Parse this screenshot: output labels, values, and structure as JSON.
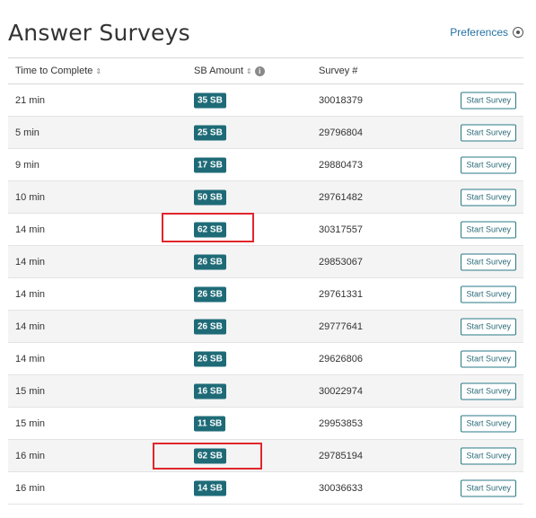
{
  "header": {
    "title": "Answer Surveys",
    "preferences_label": "Preferences"
  },
  "table": {
    "columns": {
      "time": "Time to Complete",
      "amount": "SB Amount",
      "survey": "Survey #"
    },
    "start_button_label": "Start Survey",
    "rows": [
      {
        "time": "21 min",
        "amount": "35 SB",
        "survey": "30018379"
      },
      {
        "time": "5 min",
        "amount": "25 SB",
        "survey": "29796804"
      },
      {
        "time": "9 min",
        "amount": "17 SB",
        "survey": "29880473"
      },
      {
        "time": "10 min",
        "amount": "50 SB",
        "survey": "29761482"
      },
      {
        "time": "14 min",
        "amount": "62 SB",
        "survey": "30317557"
      },
      {
        "time": "14 min",
        "amount": "26 SB",
        "survey": "29853067"
      },
      {
        "time": "14 min",
        "amount": "26 SB",
        "survey": "29761331"
      },
      {
        "time": "14 min",
        "amount": "26 SB",
        "survey": "29777641"
      },
      {
        "time": "14 min",
        "amount": "26 SB",
        "survey": "29626806"
      },
      {
        "time": "15 min",
        "amount": "16 SB",
        "survey": "30022974"
      },
      {
        "time": "15 min",
        "amount": "11 SB",
        "survey": "29953853"
      },
      {
        "time": "16 min",
        "amount": "62 SB",
        "survey": "29785194"
      },
      {
        "time": "16 min",
        "amount": "14 SB",
        "survey": "30036633"
      }
    ]
  },
  "colors": {
    "badge": "#1e6b77",
    "link": "#2471a3",
    "highlight": "#e0262b"
  }
}
